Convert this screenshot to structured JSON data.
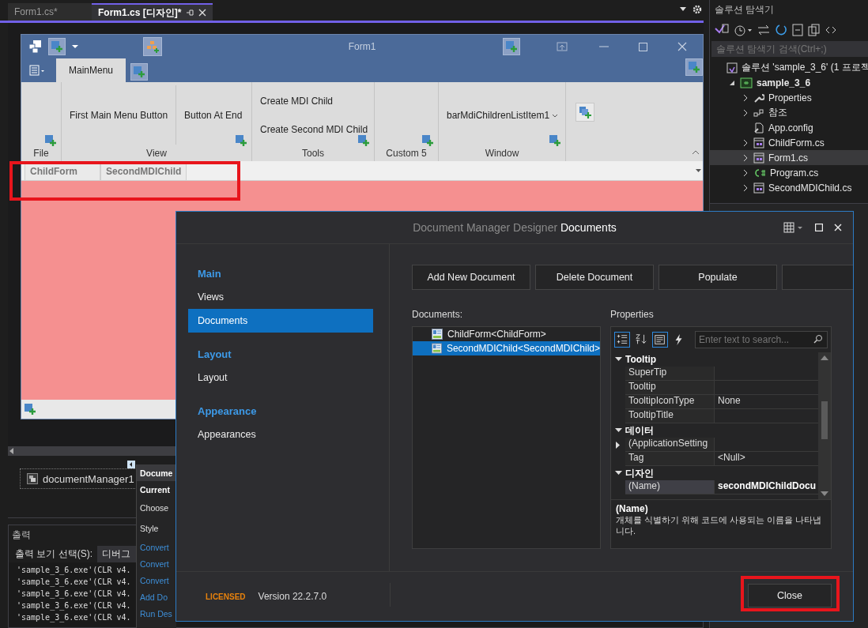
{
  "editor_tabs": [
    {
      "label": "Form1.cs*",
      "selected": false
    },
    {
      "label": "Form1.cs [디자인]*",
      "selected": true
    }
  ],
  "form": {
    "title": "Form1",
    "ribbon_tabs": [
      {
        "label": "MainMenu",
        "selected": true
      }
    ],
    "groups": [
      {
        "caption": "File",
        "kind": "empty"
      },
      {
        "caption": "View",
        "kind": "row",
        "items": [
          "First Main Menu Button",
          "Button At End"
        ]
      },
      {
        "caption": "Tools",
        "kind": "stack",
        "items": [
          "Create MDI Child",
          "Create Second MDI Child"
        ]
      },
      {
        "caption": "Custom 5",
        "kind": "empty"
      },
      {
        "caption": "Window",
        "kind": "list",
        "items": [
          "barMdiChildrenListItem1"
        ]
      }
    ],
    "document_tabs": [
      "ChildForm",
      "SecondMDIChild"
    ]
  },
  "tray": {
    "component": "documentManager1"
  },
  "smart_menu": [
    {
      "label": "Docume",
      "kind": "header"
    },
    {
      "label": "Current",
      "kind": "bold"
    },
    {
      "label": "Choose",
      "kind": "plain"
    },
    {
      "label": "Style",
      "kind": "plain"
    },
    {
      "label": "Convert",
      "kind": "link"
    },
    {
      "label": "Convert",
      "kind": "link"
    },
    {
      "label": "Convert",
      "kind": "link"
    },
    {
      "label": "Add Do",
      "kind": "link"
    },
    {
      "label": "Run Des",
      "kind": "link"
    }
  ],
  "output": {
    "title": "출력",
    "source_label": "출력 보기 선택(S):",
    "source": "디버그",
    "lines": [
      "'sample_3_6.exe'(CLR v4.",
      "'sample_3_6.exe'(CLR v4.",
      "'sample_3_6.exe'(CLR v4.",
      "'sample_3_6.exe'(CLR v4.",
      "'sample_3_6.exe'(CLR v4."
    ]
  },
  "solution_explorer": {
    "title": "솔루션 탐색기",
    "search_placeholder": "솔루션 탐색기 검색(Ctrl+;)",
    "tree": [
      {
        "label": "솔루션 'sample_3_6'  (1 프로젝",
        "kind": "solution",
        "selected": false,
        "children": [
          {
            "label": "sample_3_6",
            "kind": "project",
            "expanded": true,
            "selected": false,
            "children": [
              {
                "label": "Properties",
                "kind": "wrench",
                "expanded": false,
                "selected": false
              },
              {
                "label": "참조",
                "kind": "refs",
                "expanded": false,
                "selected": false
              },
              {
                "label": "App.config",
                "kind": "config",
                "selected": false
              },
              {
                "label": "ChildForm.cs",
                "kind": "form",
                "expanded": false,
                "selected": false
              },
              {
                "label": "Form1.cs",
                "kind": "form",
                "expanded": false,
                "selected": true
              },
              {
                "label": "Program.cs",
                "kind": "cs",
                "expanded": false,
                "selected": false
              },
              {
                "label": "SecondMDIChild.cs",
                "kind": "form",
                "expanded": false,
                "selected": false
              }
            ]
          }
        ]
      }
    ]
  },
  "dialog": {
    "title_prefix": "Document Manager Designer",
    "title": "Documents",
    "nav": [
      {
        "heading": "Main",
        "items": [
          {
            "label": "Views",
            "selected": false
          },
          {
            "label": "Documents",
            "selected": true
          }
        ]
      },
      {
        "heading": "Layout",
        "items": [
          {
            "label": "Layout",
            "selected": false
          }
        ]
      },
      {
        "heading": "Appearance",
        "items": [
          {
            "label": "Appearances",
            "selected": false
          }
        ]
      }
    ],
    "actions": [
      "Add New Document",
      "Delete Document",
      "Populate"
    ],
    "documents_label": "Documents:",
    "documents": [
      {
        "label": "ChildForm<ChildForm>",
        "selected": false
      },
      {
        "label": "SecondMDIChild<SecondMDIChild>",
        "selected": true
      }
    ],
    "properties_label": "Properties",
    "prop_tools": [
      {
        "kind": "categorized",
        "selected": true
      },
      {
        "kind": "alphabetical",
        "selected": false
      },
      {
        "kind": "pages",
        "selected": true
      },
      {
        "kind": "events",
        "selected": false
      }
    ],
    "search_placeholder": "Enter text to search...",
    "categories": [
      {
        "name": "Tooltip",
        "expanded": true,
        "rows": [
          {
            "name": "SuperTip",
            "selected": false
          },
          {
            "name": "Tooltip",
            "selected": false
          },
          {
            "name": "TooltipIconType",
            "value": "None",
            "selected": false
          },
          {
            "name": "TooltipTitle",
            "selected": false
          }
        ]
      },
      {
        "name": "데이터",
        "expanded": true,
        "rows": [
          {
            "name": "(ApplicationSetting",
            "expanded": false,
            "selected": false
          },
          {
            "name": "Tag",
            "value": "<Null>",
            "selected": false
          }
        ]
      },
      {
        "name": "디자인",
        "expanded": true,
        "rows": [
          {
            "name": "(Name)",
            "value": "secondMDIChildDocu",
            "selected": true
          }
        ]
      }
    ],
    "description": {
      "title": "(Name)",
      "text": "개체를 식별하기 위해 코드에 사용되는 이름을 나타냅니다."
    },
    "license": "LICENSED",
    "version": "Version 22.2.7.0",
    "close": "Close"
  }
}
